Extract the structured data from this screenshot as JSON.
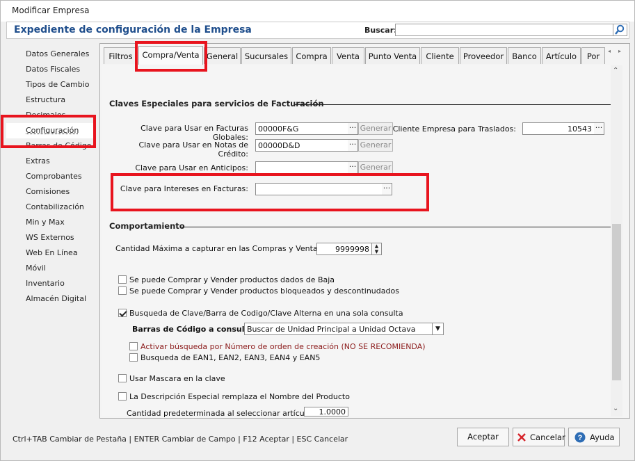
{
  "window": {
    "title": "Modificar Empresa"
  },
  "header": {
    "title": "Expediente de configuración de la Empresa",
    "search_label": "Buscar:",
    "search_value": ""
  },
  "sidebar": {
    "items": [
      "Datos Generales",
      "Datos Fiscales",
      "Tipos de Cambio",
      "Estructura",
      "Decimales",
      "Configuración",
      "Barras de Código",
      "Extras",
      "Comprobantes",
      "Comisiones",
      "Contabilización",
      "Min y Max",
      "WS Externos",
      "Web En Línea",
      "Móvil",
      "Inventario",
      "Almacén Digital"
    ],
    "selected": "Configuración"
  },
  "tabs": [
    "Filtros",
    "Compra/Venta",
    "General",
    "Sucursales",
    "Compra",
    "Venta",
    "Punto Venta",
    "Cliente",
    "Proveedor",
    "Banco",
    "Artículo",
    "Por"
  ],
  "active_tab": "Compra/Venta",
  "facturacion": {
    "section_title": "Claves Especiales para servicios de Facturación",
    "global_label": "Clave para Usar en Facturas Globales:",
    "global_value": "00000F&G",
    "notas_label": "Clave para Usar en Notas de Crédito:",
    "notas_value": "00000D&D",
    "anticipos_label": "Clave para Usar en Anticipos:",
    "anticipos_value": "",
    "intereses_label": "Clave para Intereses en Facturas:",
    "intereses_value": "",
    "generar_label": "Generar",
    "dots": "···",
    "traslados_label": "Cliente Empresa para Traslados:",
    "traslados_value": "10543"
  },
  "comportamiento": {
    "section_title": "Comportamiento",
    "cantidad_label": "Cantidad Máxima a capturar en las Compras y Ventas:",
    "cantidad_value": "9999998",
    "opt_baja": "Se puede Comprar y Vender productos dados de Baja",
    "opt_bloqueados": "Se puede Comprar y Vender productos bloqueados y descontinudados",
    "opt_busqueda": "Busqueda de Clave/Barra de Codigo/Clave Alterna en una sola consulta",
    "barras_label": "Barras de Código a consultar:",
    "barras_value": "Buscar de Unidad Principal a Unidad Octava",
    "opt_orden": "Activar búsqueda por Número de orden de creación (NO SE RECOMIENDA)",
    "opt_ean": "Busqueda de EAN1, EAN2, EAN3, EAN4 y EAN5",
    "opt_mascara": "Usar Mascara en la clave",
    "opt_descripcion": "La Descripción Especial remplaza el Nombre del Producto",
    "predeterminada_label": "Cantidad predeterminada al seleccionar artículo:",
    "predeterminada_value": "1.0000"
  },
  "footer": {
    "status": "Ctrl+TAB Cambiar de Pestaña  |  ENTER Cambiar de Campo | F12  Aceptar | ESC Cancelar",
    "aceptar": "Aceptar",
    "cancelar": "Cancelar",
    "ayuda": "Ayuda"
  },
  "colors": {
    "highlight": "#e8141e",
    "title": "#1f4e8c",
    "warning_text": "#8b1a1a"
  }
}
